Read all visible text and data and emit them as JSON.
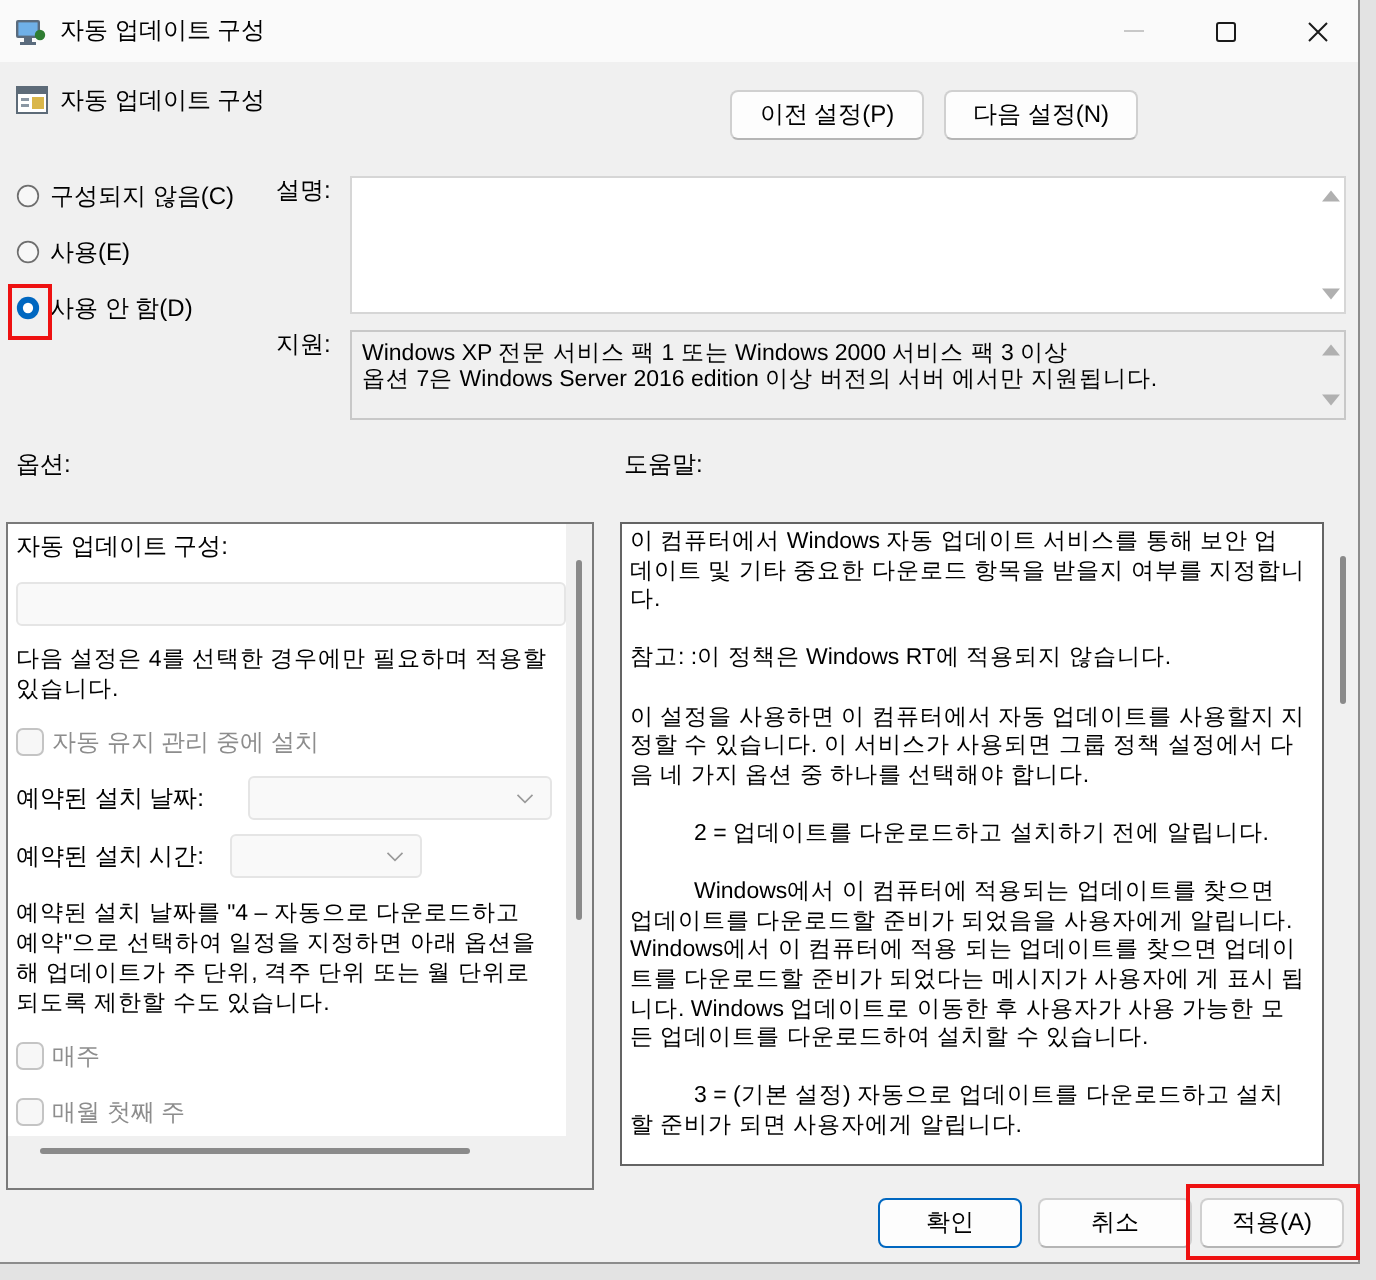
{
  "window": {
    "title": "자동 업데이트 구성",
    "minimize_enabled": false
  },
  "header": {
    "title": "자동 업데이트 구성",
    "buttons": [
      {
        "label": "이전 설정(P)"
      },
      {
        "label": "다음 설정(N)"
      }
    ]
  },
  "radios": [
    {
      "label": "구성되지 않음(C)",
      "selected": false,
      "highlighted": false
    },
    {
      "label": "사용(E)",
      "selected": false,
      "highlighted": false
    },
    {
      "label": "사용 안 함(D)",
      "selected": true,
      "highlighted": true
    }
  ],
  "comment": {
    "label": "설명:"
  },
  "supported_on": {
    "label": "지원:",
    "text": "Windows XP 전문 서비스 팩 1 또는 Windows 2000 서비스 팩 3 이상\n옵션 7은 Windows Server 2016 edition 이상 버전의 서버 에서만 지원됩니다."
  },
  "options": {
    "label": "옵션:",
    "items": [
      {
        "kind": "label",
        "text": "자동 업데이트 구성:"
      },
      {
        "kind": "dropdown",
        "disabled": true
      },
      {
        "kind": "note",
        "text": "다음 설정은 4를 선택한 경우에만 필요하며 적용할\n있습니다."
      },
      {
        "kind": "checkbox",
        "label": "자동 유지 관리 중에 설치",
        "checked": false,
        "disabled": true
      },
      {
        "kind": "dropdown",
        "label": "예약된 설치 날짜:",
        "disabled": true
      },
      {
        "kind": "dropdown",
        "label": "예약된 설치 시간:",
        "disabled": true
      },
      {
        "kind": "note",
        "text": "예약된 설치 날짜를 \"4 – 자동으로 다운로드하고\n예약\"으로 선택하여 일정을 지정하면 아래 옵션을\n해 업데이트가 주 단위, 격주 단위 또는 월 단위로\n되도록 제한할 수도 있습니다."
      },
      {
        "kind": "checkbox",
        "label": "매주",
        "checked": false,
        "disabled": true
      },
      {
        "kind": "checkbox",
        "label": "매월 첫째 주",
        "checked": false,
        "disabled": true
      }
    ]
  },
  "help": {
    "label": "도움말:",
    "paragraphs": [
      {
        "text": "이 컴퓨터에서 Windows 자동 업데이트 서비스를 통해 보안 업\n데이트 및 기타 중요한 다운로드 항목을 받을지 여부를 지정합니\n다.",
        "indented": false
      },
      {
        "text": "참고: :이 정책은 Windows RT에 적용되지 않습니다.",
        "indented": false
      },
      {
        "text": "이 설정을 사용하면 이 컴퓨터에서 자동 업데이트를 사용할지 지\n정할 수 있습니다. 이 서비스가 사용되면 그룹 정책 설정에서 다\n음 네 가지 옵션 중 하나를 선택해야 합니다.",
        "indented": false
      },
      {
        "text": "2 = 업데이트를 다운로드하고 설치하기 전에 알립니다.",
        "indented": true
      },
      {
        "text": "Windows에서 이 컴퓨터에 적용되는 업데이트를 찾으면\n업데이트를 다운로드할 준비가 되었음을 사용자에게 알립니다.\nWindows에서 이 컴퓨터에 적용 되는 업데이트를 찾으면 업데이\n트를 다운로드할 준비가 되었다는 메시지가 사용자에 게 표시 됩\n니다. Windows 업데이트로 이동한 후 사용자가 사용 가능한 모\n든 업데이트를 다운로드하여 설치할 수 있습니다.",
        "indented": true
      },
      {
        "text": "3 = (기본 설정) 자동으로 업데이트를 다운로드하고 설치\n할 준비가 되면 사용자에게 알립니다.",
        "indented": true
      }
    ]
  },
  "buttons": [
    {
      "label": "확인",
      "default": true,
      "highlighted": false
    },
    {
      "label": "취소",
      "default": false,
      "highlighted": false
    },
    {
      "label": "적용(A)",
      "default": false,
      "highlighted": true
    }
  ]
}
